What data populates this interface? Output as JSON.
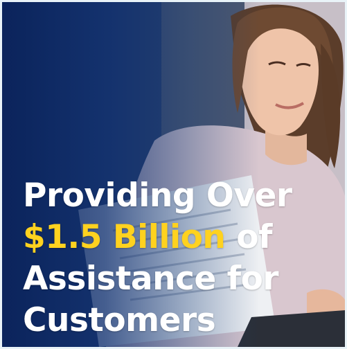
{
  "banner": {
    "line1": "Providing Over",
    "highlight": "$1.5 Billion",
    "line2_suffix": " of",
    "line3": "Assistance for",
    "line4": "Customers"
  },
  "colors": {
    "highlight": "#ffd21f",
    "text": "#ffffff",
    "overlay": "#0c2d6e"
  }
}
